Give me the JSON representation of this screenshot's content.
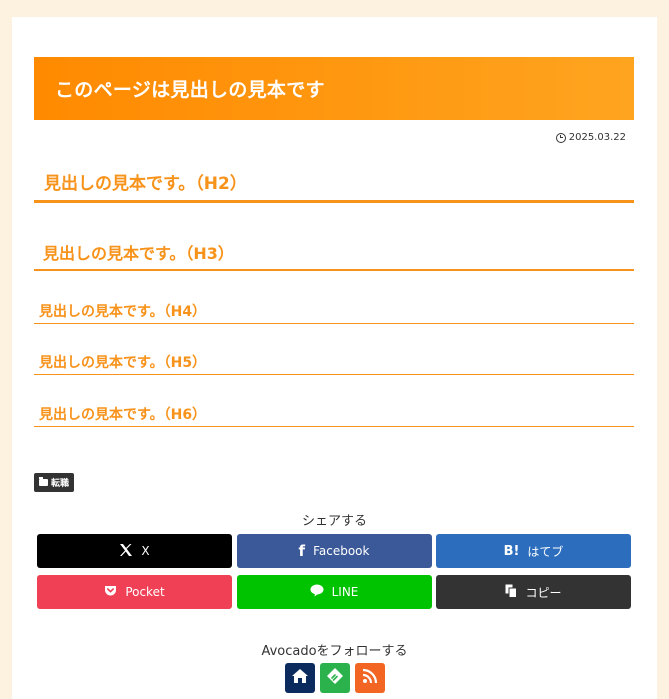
{
  "page_title": "このページは見出しの見本です",
  "date": "2025.03.22",
  "headings": {
    "h2": "見出しの見本です。（H2）",
    "h3": "見出しの見本です。（H3）",
    "h4": "見出しの見本です。（H4）",
    "h5": "見出しの見本です。（H5）",
    "h6": "見出しの見本です。（H6）"
  },
  "category": "転職",
  "share": {
    "label": "シェアする",
    "buttons": [
      {
        "label": "X",
        "icon": "x-icon",
        "color": "#000000"
      },
      {
        "label": "Facebook",
        "icon": "facebook-icon",
        "color": "#3b5998"
      },
      {
        "label": "はてブ",
        "icon": "hatena-icon",
        "color": "#2c6ebd"
      },
      {
        "label": "Pocket",
        "icon": "pocket-icon",
        "color": "#ef4056"
      },
      {
        "label": "LINE",
        "icon": "line-icon",
        "color": "#00c300"
      },
      {
        "label": "コピー",
        "icon": "copy-icon",
        "color": "#333333"
      }
    ]
  },
  "follow": {
    "label": "Avocadoをフォローする",
    "buttons": [
      {
        "icon": "home-icon",
        "color": "#0b2b5e"
      },
      {
        "icon": "feedly-icon",
        "color": "#2bb24c"
      },
      {
        "icon": "rss-icon",
        "color": "#f26522"
      }
    ]
  },
  "colors": {
    "accent": "#f7921a",
    "background": "#fdf1df"
  }
}
